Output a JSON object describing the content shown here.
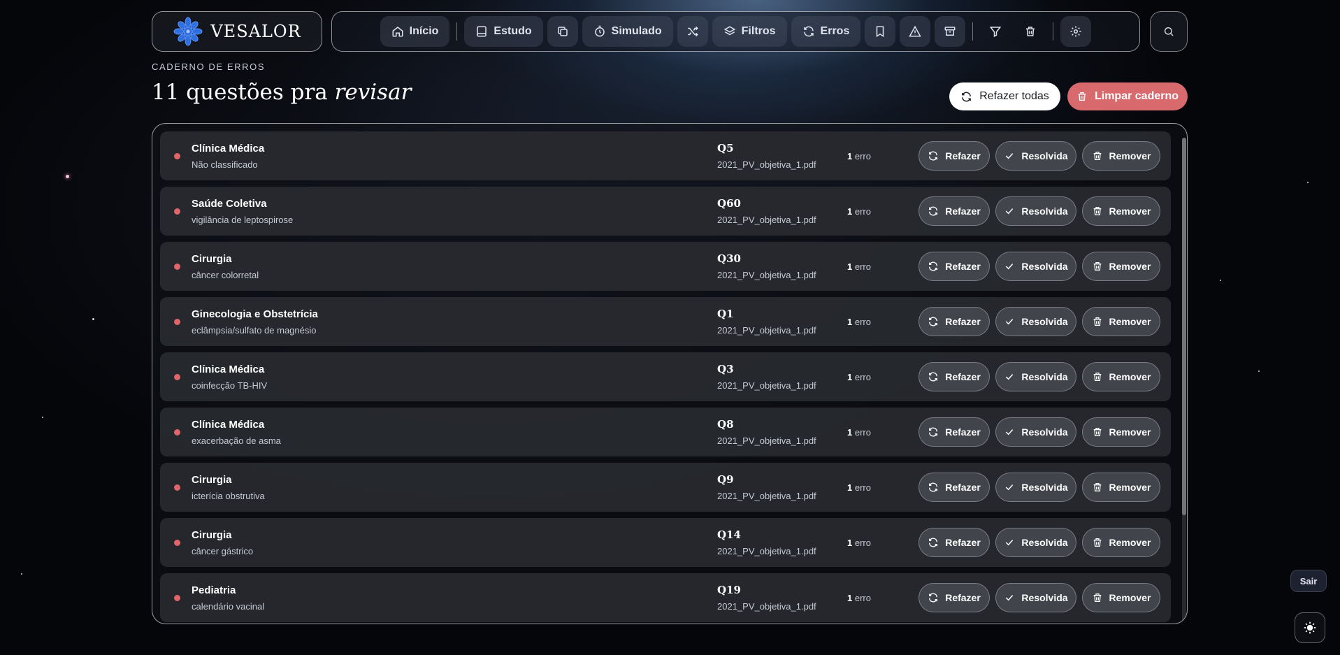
{
  "brand": {
    "name": "VESALOR"
  },
  "nav": {
    "items": [
      {
        "label": "Início",
        "icon": "home-icon"
      },
      {
        "label": "Estudo",
        "icon": "book-icon"
      },
      {
        "label": "",
        "icon": "copy-icon"
      },
      {
        "label": "Simulado",
        "icon": "timer-icon"
      },
      {
        "label": "",
        "icon": "shuffle-icon"
      },
      {
        "label": "Filtros",
        "icon": "layers-icon"
      },
      {
        "label": "Erros",
        "icon": "refresh-icon"
      }
    ],
    "tools": [
      "bookmark-icon",
      "alert-icon",
      "archive-icon",
      "filter-icon",
      "trash-icon",
      "gear-icon"
    ],
    "search_icon": "search-icon"
  },
  "page": {
    "eyebrow": "CADERNO DE ERROS",
    "title_prefix": "11 questões pra ",
    "title_accent": "revisar",
    "refazer_todas": "Refazer todas",
    "limpar_caderno": "Limpar caderno"
  },
  "row_actions": {
    "refazer": "Refazer",
    "resolvida": "Resolvida",
    "remover": "Remover"
  },
  "error_label": "erro",
  "rows": [
    {
      "area": "Clínica Médica",
      "topic": "Não classificado",
      "q": "Q5",
      "file": "2021_PV_objetiva_1.pdf",
      "errors": "1"
    },
    {
      "area": "Saúde Coletiva",
      "topic": "vigilância de leptospirose",
      "q": "Q60",
      "file": "2021_PV_objetiva_1.pdf",
      "errors": "1"
    },
    {
      "area": "Cirurgia",
      "topic": "câncer colorretal",
      "q": "Q30",
      "file": "2021_PV_objetiva_1.pdf",
      "errors": "1"
    },
    {
      "area": "Ginecologia e Obstetrícia",
      "topic": "eclâmpsia/sulfato de magnésio",
      "q": "Q1",
      "file": "2021_PV_objetiva_1.pdf",
      "errors": "1"
    },
    {
      "area": "Clínica Médica",
      "topic": "coinfecção TB-HIV",
      "q": "Q3",
      "file": "2021_PV_objetiva_1.pdf",
      "errors": "1"
    },
    {
      "area": "Clínica Médica",
      "topic": "exacerbação de asma",
      "q": "Q8",
      "file": "2021_PV_objetiva_1.pdf",
      "errors": "1"
    },
    {
      "area": "Cirurgia",
      "topic": "icterícia obstrutiva",
      "q": "Q9",
      "file": "2021_PV_objetiva_1.pdf",
      "errors": "1"
    },
    {
      "area": "Cirurgia",
      "topic": "câncer gástrico",
      "q": "Q14",
      "file": "2021_PV_objetiva_1.pdf",
      "errors": "1"
    },
    {
      "area": "Pediatria",
      "topic": "calendário vacinal",
      "q": "Q19",
      "file": "2021_PV_objetiva_1.pdf",
      "errors": "1"
    }
  ],
  "footer": {
    "sair": "Sair",
    "theme_icon": "sun-icon"
  },
  "colors": {
    "accent_red": "#d86a6e",
    "dot_red": "#e06468",
    "row_bg": "#2a2c32",
    "logo_blue": "#2f6fe0"
  }
}
